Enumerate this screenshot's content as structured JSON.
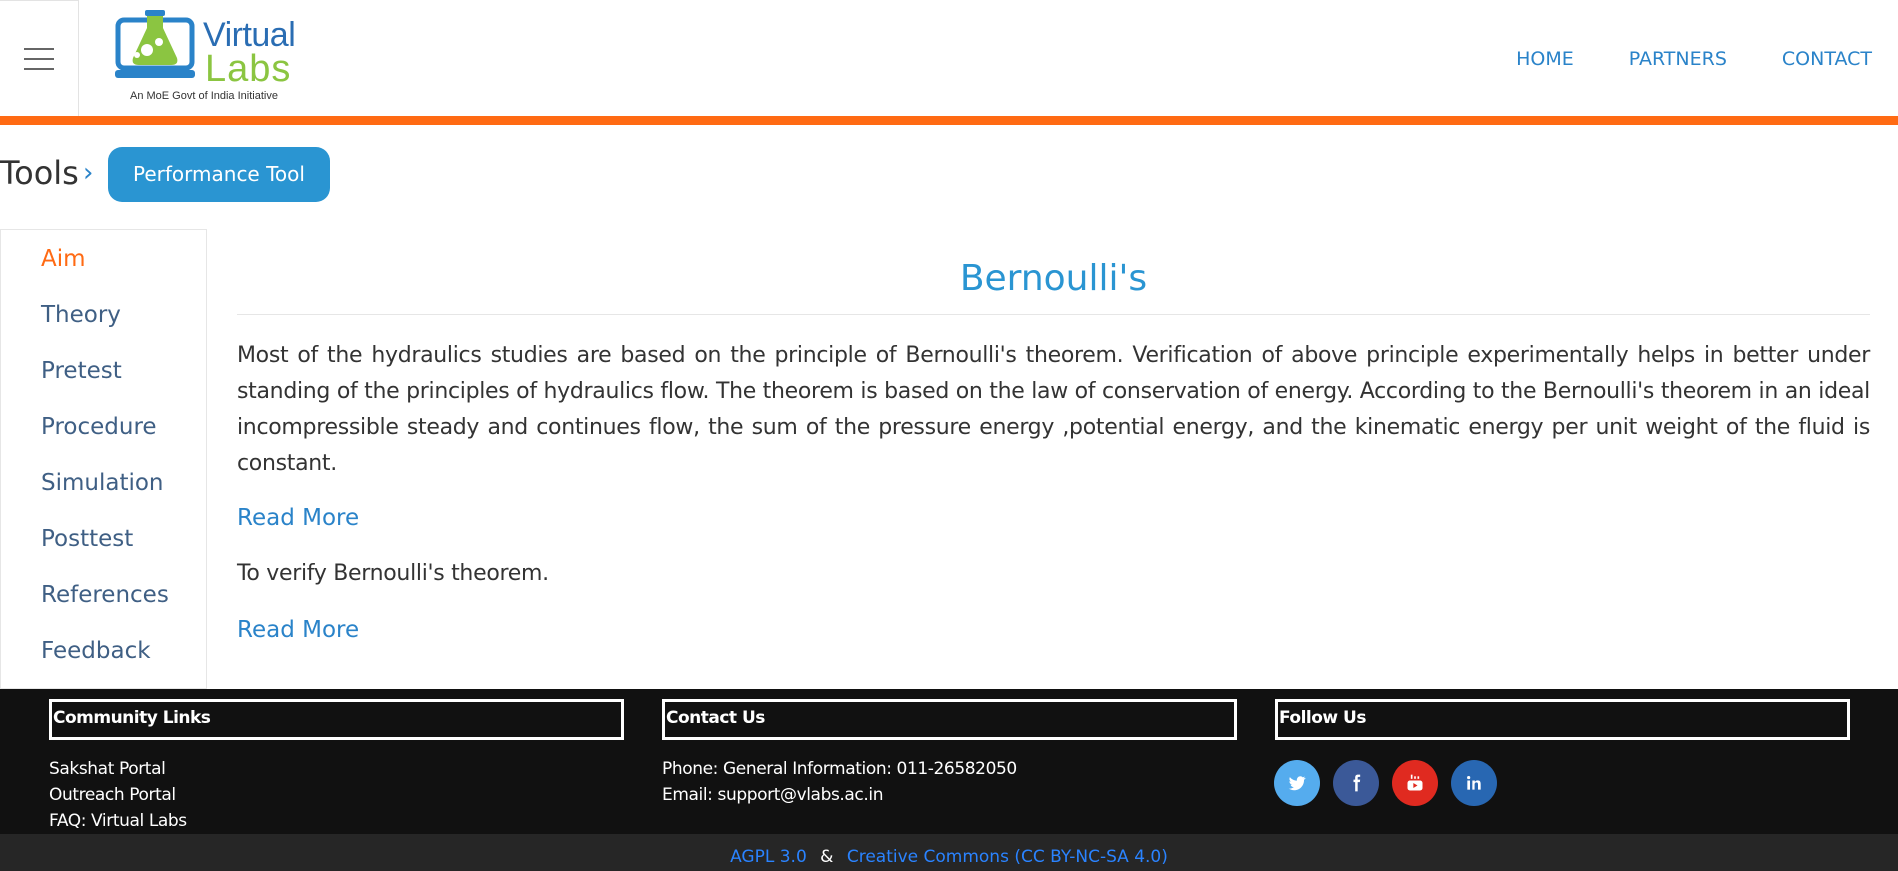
{
  "header": {
    "logo_title": "Virtual",
    "logo_sub": "Labs",
    "logo_tagline": "An MoE Govt of India Initiative",
    "nav": [
      "HOME",
      "PARTNERS",
      "CONTACT"
    ]
  },
  "breadcrumb": {
    "label": "Tools",
    "current": "Performance Tool"
  },
  "sidebar": {
    "items": [
      "Aim",
      "Theory",
      "Pretest",
      "Procedure",
      "Simulation",
      "Posttest",
      "References",
      "Feedback"
    ],
    "active": "Aim"
  },
  "main": {
    "title": "Bernoulli's",
    "intro": "Most of the hydraulics studies are based on the principle of Bernoulli's theorem. Verification of above principle experimentally helps in better under standing of the principles of hydraulics flow. The theorem is based on the law of conservation of energy. According to the Bernoulli's theorem in an ideal incompressible steady and continues flow, the sum of the pressure energy ,potential energy, and the kinematic energy per unit weight of the fluid is constant.",
    "read_more_1": "Read More",
    "aim": "To verify Bernoulli's theorem.",
    "read_more_2": "Read More"
  },
  "footer": {
    "community_heading": "Community Links",
    "community_links": [
      "Sakshat Portal",
      "Outreach Portal",
      "FAQ: Virtual Labs"
    ],
    "contact_heading": "Contact Us",
    "phone": "Phone: General Information: 011-26582050",
    "email": "Email: support@vlabs.ac.in",
    "follow_heading": "Follow Us",
    "social": [
      {
        "name": "twitter-icon",
        "color": "#55acee"
      },
      {
        "name": "facebook-icon",
        "color": "#3b5998"
      },
      {
        "name": "youtube-icon",
        "color": "#e02a20"
      },
      {
        "name": "linkedin-icon",
        "color": "#2867b2"
      }
    ],
    "license_1": "AGPL 3.0",
    "license_sep": "&",
    "license_2": "Creative Commons (CC BY-NC-SA 4.0)"
  },
  "colors": {
    "accent_orange": "#ff6a13",
    "link_blue": "#2a83c9",
    "title_blue": "#2a95d2"
  }
}
